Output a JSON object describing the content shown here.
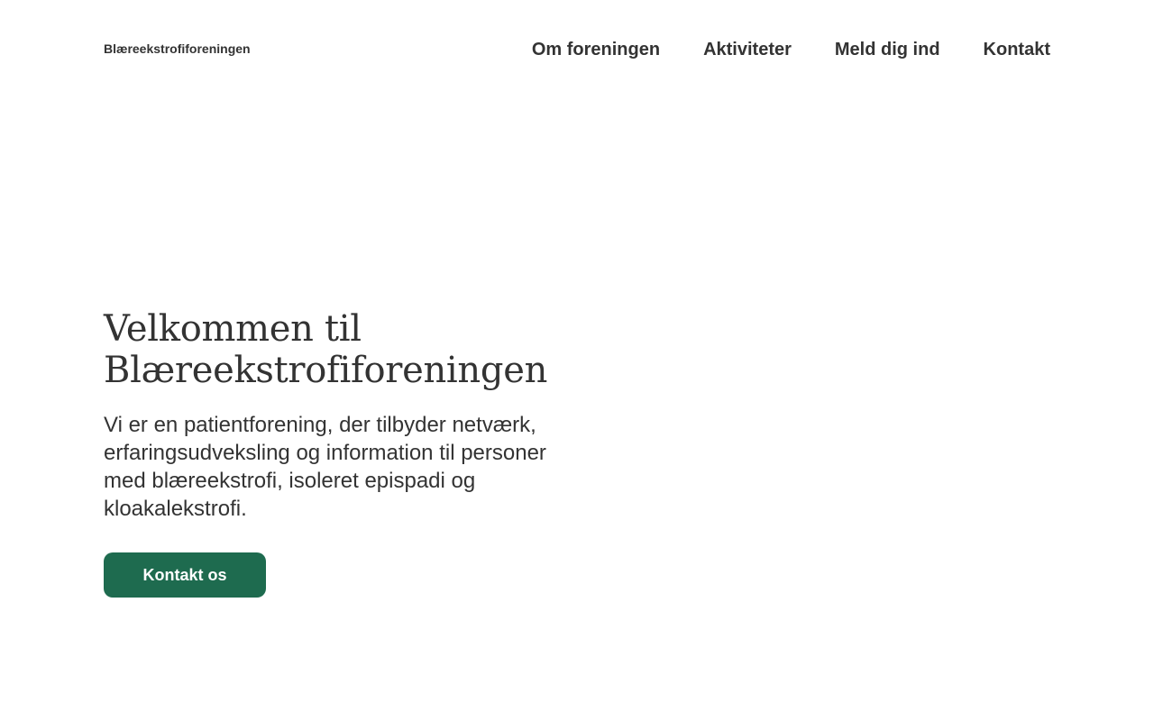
{
  "header": {
    "brand": "Blæreekstrofiforeningen",
    "nav": [
      {
        "label": "Om foreningen"
      },
      {
        "label": "Aktiviteter"
      },
      {
        "label": "Meld dig ind"
      },
      {
        "label": "Kontakt"
      }
    ]
  },
  "hero": {
    "title_line1": "Velkommen til",
    "title_line2": "Blæreekstrofiforeningen",
    "text": "Vi er en patientforening, der tilbyder netværk, erfaringsudveksling og information til personer med blæreekstrofi, isoleret epispadi og kloakalekstrofi.",
    "cta_label": "Kontakt os"
  },
  "colors": {
    "text": "#333333",
    "accent": "#1e6b4f",
    "background": "#ffffff"
  }
}
